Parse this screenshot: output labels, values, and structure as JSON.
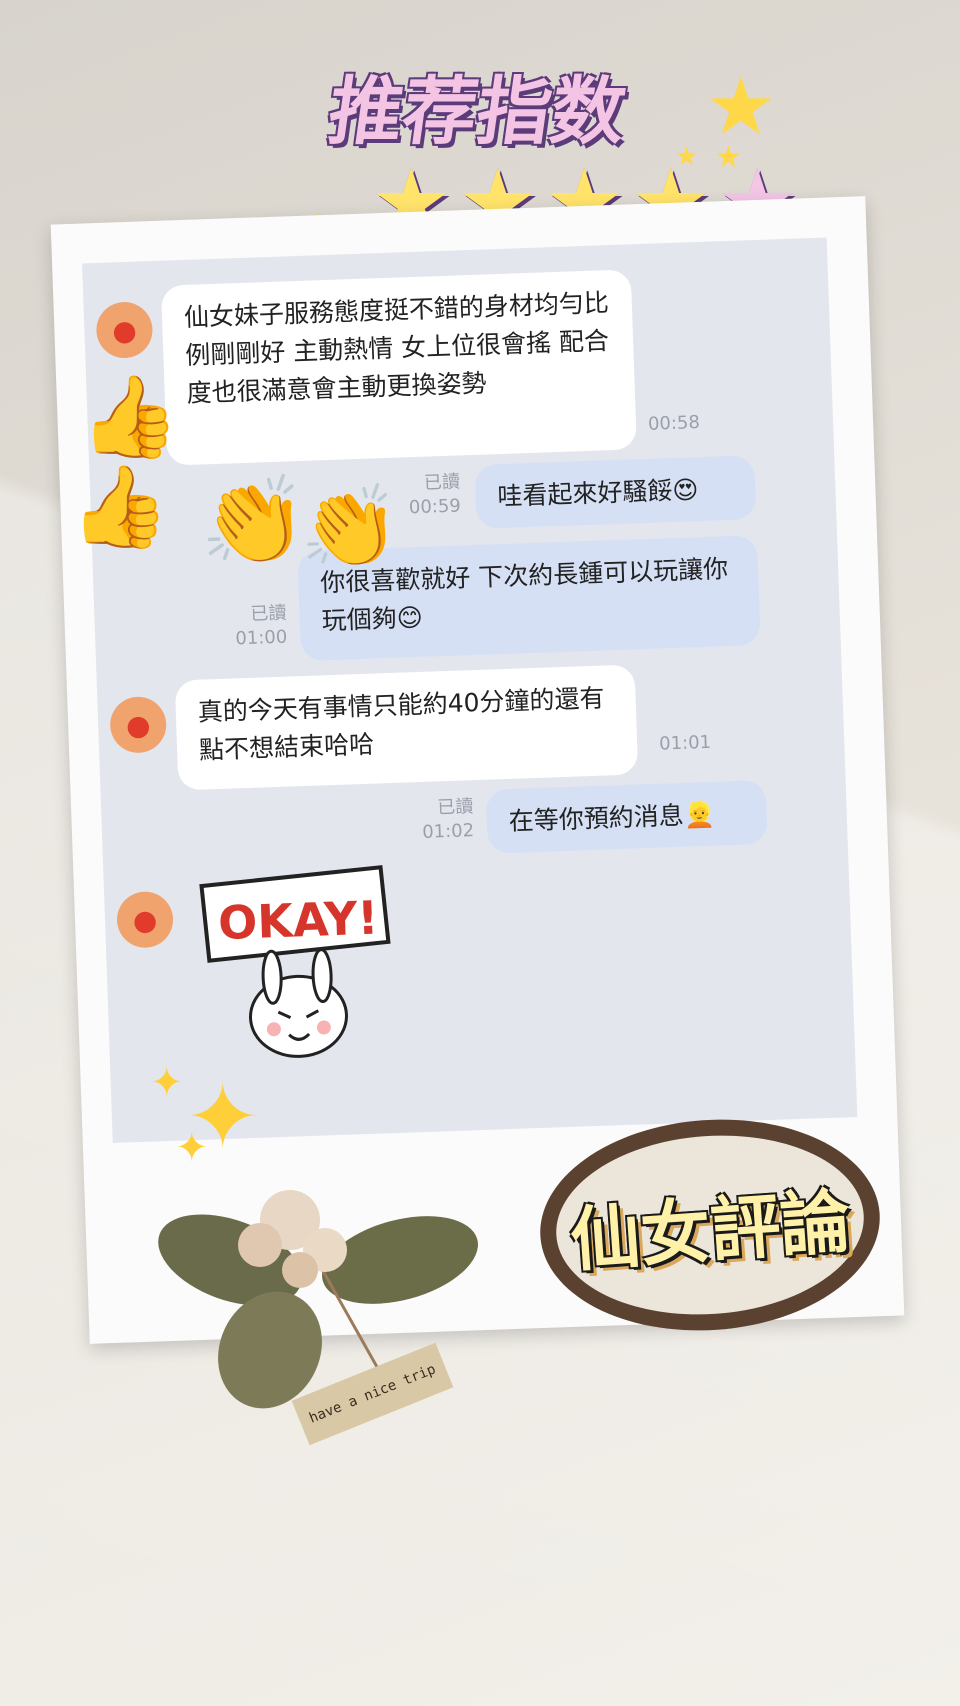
{
  "title": {
    "text": "推荐指数",
    "rating": 5,
    "icon": "star-icon"
  },
  "chat": {
    "messages": [
      {
        "from": "left",
        "text": "仙女妹子服務態度挺不錯的身材均勻比例剛剛好 主動熱情 女上位很會搖 配合度也很滿意會主動更換姿勢",
        "time": "00:58"
      },
      {
        "from": "right",
        "text": "哇看起來好騷餒😍",
        "read": "已讀",
        "time": "00:59"
      },
      {
        "from": "right",
        "text": "你很喜歡就好 下次約長鍾可以玩讓你玩個夠😊",
        "read": "已讀",
        "time": "01:00"
      },
      {
        "from": "left",
        "text": "真的今天有事情只能約40分鐘的還有點不想結束哈哈",
        "time": "01:01"
      },
      {
        "from": "right",
        "text": "在等你預約消息👱",
        "read": "已讀",
        "time": "01:02"
      }
    ],
    "sticker_text": "OKAY!",
    "avatar_icon": "apple-icon"
  },
  "badge": {
    "text": "仙女評論"
  },
  "tape": {
    "text": "have a nice trip"
  },
  "colors": {
    "bubble_in": "#ffffff",
    "bubble_out": "#d6e0f5",
    "chat_bg": "#e4e6ee",
    "accent_star": "#ffe36a"
  }
}
